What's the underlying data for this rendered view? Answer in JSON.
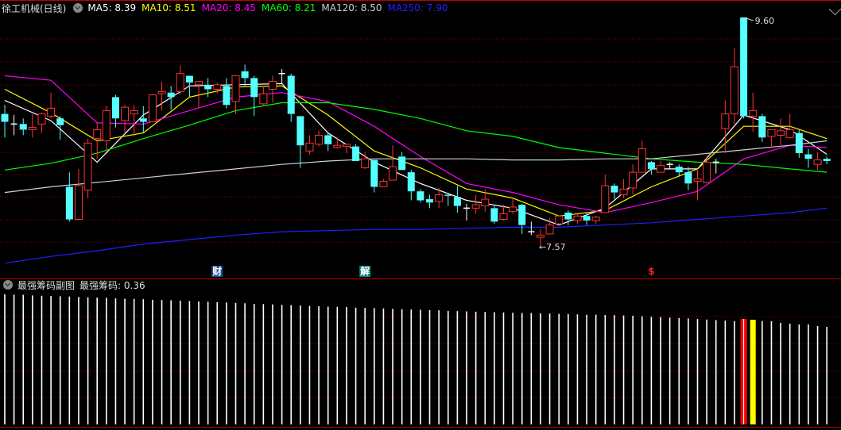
{
  "header": {
    "title": "徐工机械(日线)",
    "ma_labels": [
      {
        "text": "MA5: 8.39",
        "color": "#ffffff"
      },
      {
        "text": "MA10: 8.51",
        "color": "#ffff00"
      },
      {
        "text": "MA20: 8.45",
        "color": "#ff00ff"
      },
      {
        "text": "MA60: 8.21",
        "color": "#00ff00"
      },
      {
        "text": "MA120: 8.50",
        "color": "#d0d0d0"
      },
      {
        "text": "MA250: 7.90",
        "color": "#2020ff"
      }
    ]
  },
  "sub_panel": {
    "title": "最强筹码副图",
    "indicator_label": "最强筹码: 0.36"
  },
  "colors": {
    "up": "#ff3232",
    "down": "#54ffff",
    "flat": "#ffffff",
    "grid": "#7a0000",
    "border": "#c00000",
    "bar": "#ffffff",
    "bar_red": "#ff0000",
    "bar_yellow": "#ffff00"
  },
  "chart_data": [
    {
      "type": "candlestick",
      "title": "徐工机械(日线)",
      "candle_format": [
        "open",
        "high",
        "low",
        "close"
      ],
      "y_range": [
        7.57,
        9.6
      ],
      "candles": [
        [
          8.74,
          8.82,
          8.53,
          8.67
        ],
        [
          8.65,
          8.73,
          8.55,
          8.65
        ],
        [
          8.65,
          8.7,
          8.55,
          8.6
        ],
        [
          8.6,
          8.74,
          8.53,
          8.62
        ],
        [
          8.65,
          8.75,
          8.57,
          8.74
        ],
        [
          8.72,
          8.93,
          8.7,
          8.79
        ],
        [
          8.7,
          8.72,
          8.51,
          8.64
        ],
        [
          8.09,
          8.22,
          7.78,
          7.8
        ],
        [
          7.8,
          8.25,
          7.79,
          8.1
        ],
        [
          8.06,
          8.52,
          7.99,
          8.48
        ],
        [
          8.52,
          8.67,
          8.34,
          8.6
        ],
        [
          8.5,
          8.81,
          8.41,
          8.77
        ],
        [
          8.89,
          8.91,
          8.62,
          8.7
        ],
        [
          8.68,
          8.82,
          8.57,
          8.8
        ],
        [
          8.74,
          8.82,
          8.54,
          8.77
        ],
        [
          8.7,
          8.81,
          8.57,
          8.67
        ],
        [
          8.67,
          8.91,
          8.67,
          8.91
        ],
        [
          8.92,
          9.03,
          8.77,
          8.94
        ],
        [
          8.93,
          8.99,
          8.78,
          8.89
        ],
        [
          8.94,
          9.17,
          8.91,
          9.1
        ],
        [
          9.08,
          9.08,
          8.89,
          9.02
        ],
        [
          9.0,
          9.03,
          8.79,
          9.03
        ],
        [
          9.0,
          9.06,
          8.89,
          8.96
        ],
        [
          8.96,
          9.02,
          8.92,
          9.0
        ],
        [
          8.99,
          9.06,
          8.79,
          8.82
        ],
        [
          8.85,
          9.08,
          8.74,
          9.08
        ],
        [
          9.12,
          9.18,
          8.99,
          9.06
        ],
        [
          9.06,
          9.08,
          8.72,
          8.89
        ],
        [
          8.83,
          8.99,
          8.82,
          8.92
        ],
        [
          8.96,
          9.08,
          8.84,
          9.03
        ],
        [
          9.1,
          9.14,
          9.01,
          9.1
        ],
        [
          9.08,
          9.1,
          8.67,
          8.74
        ],
        [
          8.72,
          8.72,
          8.26,
          8.46
        ],
        [
          8.41,
          8.55,
          8.38,
          8.48
        ],
        [
          8.47,
          8.59,
          8.45,
          8.55
        ],
        [
          8.55,
          8.57,
          8.41,
          8.47
        ],
        [
          8.44,
          8.53,
          8.43,
          8.46
        ],
        [
          8.45,
          8.47,
          8.39,
          8.47
        ],
        [
          8.45,
          8.47,
          8.32,
          8.32
        ],
        [
          8.26,
          8.4,
          8.25,
          8.34
        ],
        [
          8.33,
          8.33,
          8.04,
          8.09
        ],
        [
          8.09,
          8.16,
          8.09,
          8.14
        ],
        [
          8.15,
          8.46,
          8.15,
          8.27
        ],
        [
          8.36,
          8.4,
          8.24,
          8.24
        ],
        [
          8.22,
          8.24,
          7.97,
          8.05
        ],
        [
          8.05,
          8.07,
          7.95,
          7.97
        ],
        [
          7.98,
          8.02,
          7.9,
          7.95
        ],
        [
          7.96,
          8.08,
          7.9,
          8.02
        ],
        [
          8.02,
          8.02,
          7.92,
          8.01
        ],
        [
          8.0,
          8.1,
          7.86,
          7.92
        ],
        [
          7.9,
          7.94,
          7.79,
          7.9
        ],
        [
          7.9,
          8.02,
          7.85,
          7.93
        ],
        [
          7.92,
          8.07,
          7.87,
          7.98
        ],
        [
          7.9,
          7.92,
          7.76,
          7.78
        ],
        [
          7.8,
          7.93,
          7.79,
          7.85
        ],
        [
          7.87,
          7.99,
          7.85,
          7.91
        ],
        [
          7.93,
          7.94,
          7.67,
          7.75
        ],
        [
          7.69,
          7.78,
          7.66,
          7.69
        ],
        [
          7.64,
          7.71,
          7.57,
          7.66
        ],
        [
          7.67,
          7.81,
          7.67,
          7.75
        ],
        [
          7.76,
          7.83,
          7.75,
          7.83
        ],
        [
          7.86,
          7.88,
          7.75,
          7.8
        ],
        [
          7.79,
          7.85,
          7.76,
          7.83
        ],
        [
          7.83,
          7.86,
          7.75,
          7.79
        ],
        [
          7.79,
          7.83,
          7.76,
          7.82
        ],
        [
          7.86,
          8.2,
          7.86,
          8.1
        ],
        [
          8.1,
          8.12,
          7.98,
          8.04
        ],
        [
          8.02,
          8.16,
          7.99,
          8.07
        ],
        [
          8.08,
          8.29,
          8.02,
          8.22
        ],
        [
          8.22,
          8.5,
          8.22,
          8.43
        ],
        [
          8.31,
          8.32,
          8.2,
          8.25
        ],
        [
          8.22,
          8.32,
          8.22,
          8.28
        ],
        [
          8.29,
          8.31,
          8.25,
          8.29
        ],
        [
          8.27,
          8.29,
          8.18,
          8.22
        ],
        [
          8.22,
          8.27,
          8.06,
          8.12
        ],
        [
          8.14,
          8.24,
          7.97,
          8.16
        ],
        [
          8.13,
          8.36,
          8.12,
          8.31
        ],
        [
          8.31,
          8.34,
          8.21,
          8.31
        ],
        [
          8.61,
          8.86,
          8.39,
          8.74
        ],
        [
          8.74,
          9.33,
          8.65,
          9.16
        ],
        [
          9.6,
          9.6,
          8.7,
          8.72
        ],
        [
          8.72,
          8.93,
          8.58,
          8.77
        ],
        [
          8.72,
          8.74,
          8.49,
          8.53
        ],
        [
          8.54,
          8.6,
          8.44,
          8.6
        ],
        [
          8.55,
          8.7,
          8.46,
          8.59
        ],
        [
          8.53,
          8.74,
          8.52,
          8.6
        ],
        [
          8.57,
          8.6,
          8.35,
          8.39
        ],
        [
          8.38,
          8.43,
          8.26,
          8.34
        ],
        [
          8.29,
          8.4,
          8.24,
          8.33
        ],
        [
          8.34,
          8.36,
          8.29,
          8.32
        ]
      ],
      "ma_sample_indices": [
        0,
        5,
        10,
        15,
        20,
        25,
        30,
        35,
        40,
        45,
        50,
        55,
        60,
        65,
        70,
        75,
        80,
        85,
        89
      ],
      "ma_series": [
        {
          "name": "MA5",
          "color": "#ffffff",
          "values": [
            8.86,
            8.68,
            8.31,
            8.73,
            8.99,
            9.0,
            9.01,
            8.57,
            8.31,
            8.12,
            7.97,
            7.9,
            7.75,
            7.9,
            8.25,
            8.25,
            8.73,
            8.6,
            8.38
          ]
        },
        {
          "name": "MA10",
          "color": "#ffff00",
          "values": [
            8.96,
            8.75,
            8.5,
            8.57,
            8.89,
            8.98,
            8.99,
            8.73,
            8.41,
            8.26,
            8.07,
            7.99,
            7.83,
            7.88,
            8.09,
            8.25,
            8.63,
            8.63,
            8.52
          ]
        },
        {
          "name": "MA20",
          "color": "#ff00ff",
          "values": [
            9.08,
            9.04,
            8.66,
            8.65,
            8.77,
            8.89,
            8.93,
            8.85,
            8.63,
            8.36,
            8.12,
            8.04,
            7.93,
            7.86,
            7.95,
            8.05,
            8.34,
            8.46,
            8.44
          ]
        },
        {
          "name": "MA60",
          "color": "#00ff00",
          "values": [
            8.24,
            8.3,
            8.39,
            8.52,
            8.64,
            8.77,
            8.84,
            8.84,
            8.78,
            8.7,
            8.59,
            8.54,
            8.44,
            8.39,
            8.34,
            8.31,
            8.29,
            8.25,
            8.22
          ]
        },
        {
          "name": "MA120",
          "color": "#d0d0d0",
          "values": [
            8.04,
            8.09,
            8.13,
            8.17,
            8.21,
            8.25,
            8.29,
            8.32,
            8.34,
            8.34,
            8.34,
            8.33,
            8.33,
            8.34,
            8.34,
            8.38,
            8.42,
            8.46,
            8.5
          ]
        },
        {
          "name": "MA250",
          "color": "#2020ff",
          "values": [
            7.41,
            7.47,
            7.52,
            7.58,
            7.62,
            7.66,
            7.69,
            7.7,
            7.71,
            7.71,
            7.72,
            7.73,
            7.73,
            7.75,
            7.77,
            7.8,
            7.83,
            7.86,
            7.9
          ]
        }
      ],
      "annotations": [
        {
          "text": "9.60",
          "candle": 80,
          "price": 9.6,
          "kind": "max"
        },
        {
          "text": "7.57",
          "candle": 58,
          "price": 7.57,
          "kind": "min"
        }
      ],
      "event_markers": [
        {
          "text": "财",
          "candle": 23,
          "bg": "#1c4f86",
          "color": "#ffffff"
        },
        {
          "text": "解",
          "candle": 39,
          "bg": "#0f7f7f",
          "color": "#ffffff"
        },
        {
          "text": "$",
          "candle": 70,
          "bg": "",
          "color": "#ff2020"
        }
      ]
    },
    {
      "type": "bar",
      "title": "最强筹码副图",
      "highlight": {
        "80": "red",
        "81": "yellow"
      },
      "values": [
        0.48,
        0.479,
        0.478,
        0.476,
        0.475,
        0.474,
        0.473,
        0.472,
        0.47,
        0.469,
        0.468,
        0.467,
        0.465,
        0.464,
        0.463,
        0.462,
        0.46,
        0.459,
        0.458,
        0.457,
        0.455,
        0.454,
        0.453,
        0.451,
        0.45,
        0.448,
        0.447,
        0.445,
        0.444,
        0.443,
        0.441,
        0.44,
        0.439,
        0.437,
        0.436,
        0.435,
        0.434,
        0.433,
        0.431,
        0.43,
        0.429,
        0.428,
        0.426,
        0.425,
        0.424,
        0.423,
        0.422,
        0.421,
        0.419,
        0.418,
        0.417,
        0.416,
        0.415,
        0.414,
        0.413,
        0.412,
        0.411,
        0.411,
        0.41,
        0.409,
        0.408,
        0.407,
        0.406,
        0.405,
        0.405,
        0.404,
        0.403,
        0.402,
        0.401,
        0.399,
        0.397,
        0.396,
        0.394,
        0.393,
        0.391,
        0.389,
        0.387,
        0.385,
        0.383,
        0.381,
        0.389,
        0.386,
        0.381,
        0.381,
        0.375,
        0.372,
        0.369,
        0.369,
        0.363,
        0.36
      ]
    }
  ]
}
